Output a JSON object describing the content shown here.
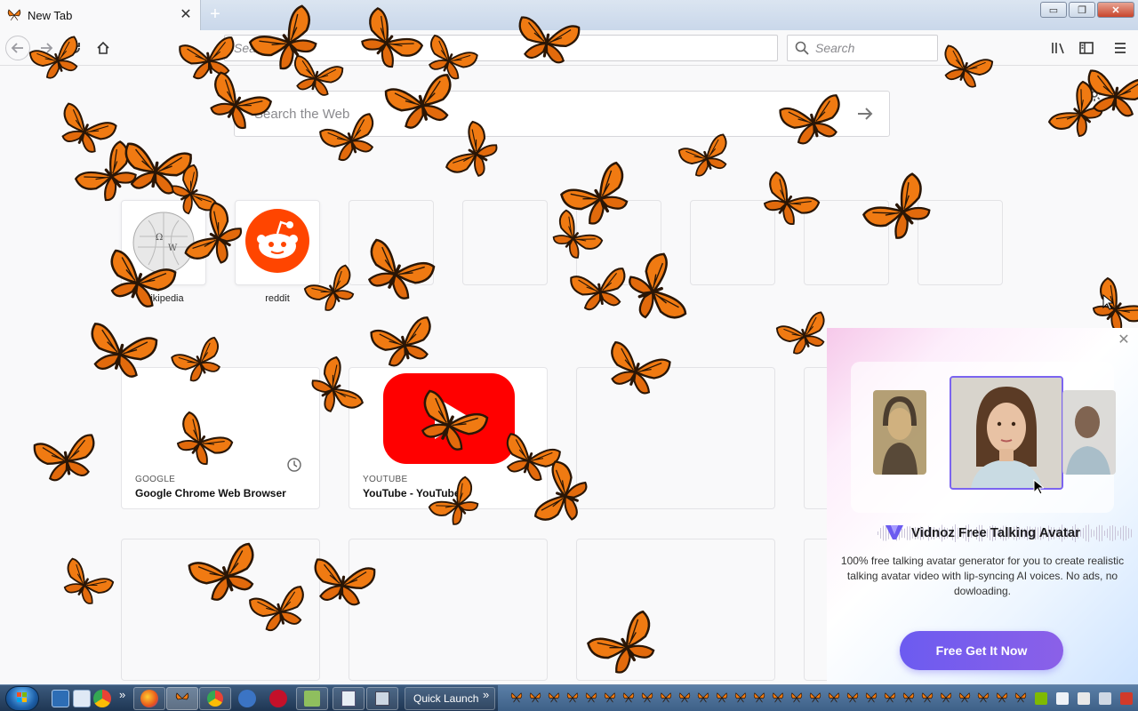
{
  "browser": {
    "tab": {
      "title": "New Tab",
      "close_glyph": "✕"
    },
    "new_tab_glyph": "+",
    "window_buttons": {
      "minimize": "▭",
      "restore": "❐",
      "close": "✕"
    },
    "url_placeholder": "Search",
    "search_placeholder": "Search",
    "icons": [
      "back-icon",
      "forward-icon",
      "reload-icon",
      "home-icon",
      "library-icon",
      "sidebar-icon",
      "menu-icon"
    ]
  },
  "newtab": {
    "search_placeholder": "Search the Web",
    "top_sites": [
      {
        "label": "wikipedia",
        "icon": "wikipedia-icon"
      },
      {
        "label": "reddit",
        "icon": "reddit-icon"
      },
      {
        "label": ""
      },
      {
        "label": ""
      },
      {
        "label": ""
      },
      {
        "label": ""
      },
      {
        "label": ""
      },
      {
        "label": ""
      }
    ],
    "highlights": [
      {
        "source": "GOOGLE",
        "title": "Google Chrome Web Browser"
      },
      {
        "source": "YOUTUBE",
        "title": "YouTube - YouTube"
      }
    ]
  },
  "ad": {
    "brand": "Vidnoz Free Talking Avatar",
    "description": "100% free talking avatar generator for you to create realistic talking avatar video with lip-syncing AI voices. No ads, no dowloading.",
    "cta": "Free Get It Now",
    "close_glyph": "✕"
  },
  "taskbar": {
    "quick_launch": "Quick Launch",
    "chevron": "»"
  },
  "colors": {
    "butterfly_orange": "#f07a12",
    "butterfly_dark": "#2a1606",
    "reddit": "#ff4500",
    "youtube": "#ff0000",
    "cta": "#6c5bf0"
  }
}
